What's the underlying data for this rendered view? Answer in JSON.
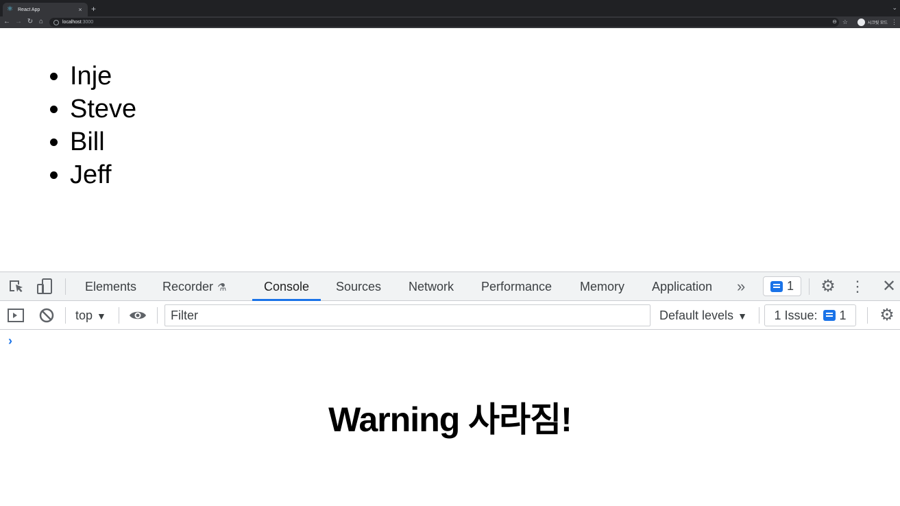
{
  "browser": {
    "tab_title": "React App",
    "tab_close": "×",
    "new_tab": "+",
    "url_host": "localhost",
    "url_port": ":3000",
    "profile_label": "시크릿 모드"
  },
  "page": {
    "names": [
      "Inje",
      "Steve",
      "Bill",
      "Jeff"
    ]
  },
  "devtools": {
    "tabs": [
      {
        "label": "Elements",
        "active": false
      },
      {
        "label": "Recorder",
        "active": false
      },
      {
        "label": "Console",
        "active": true
      },
      {
        "label": "Sources",
        "active": false
      },
      {
        "label": "Network",
        "active": false
      },
      {
        "label": "Performance",
        "active": false
      },
      {
        "label": "Memory",
        "active": false
      },
      {
        "label": "Application",
        "active": false
      }
    ],
    "more_tabs": "»",
    "message_count": "1",
    "context": "top",
    "filter_placeholder": "Filter",
    "levels": "Default levels",
    "issues_label": "1 Issue:",
    "issues_count": "1",
    "prompt": "›",
    "accent_color": "#1a73e8"
  },
  "caption": "Warning 사라짐!"
}
